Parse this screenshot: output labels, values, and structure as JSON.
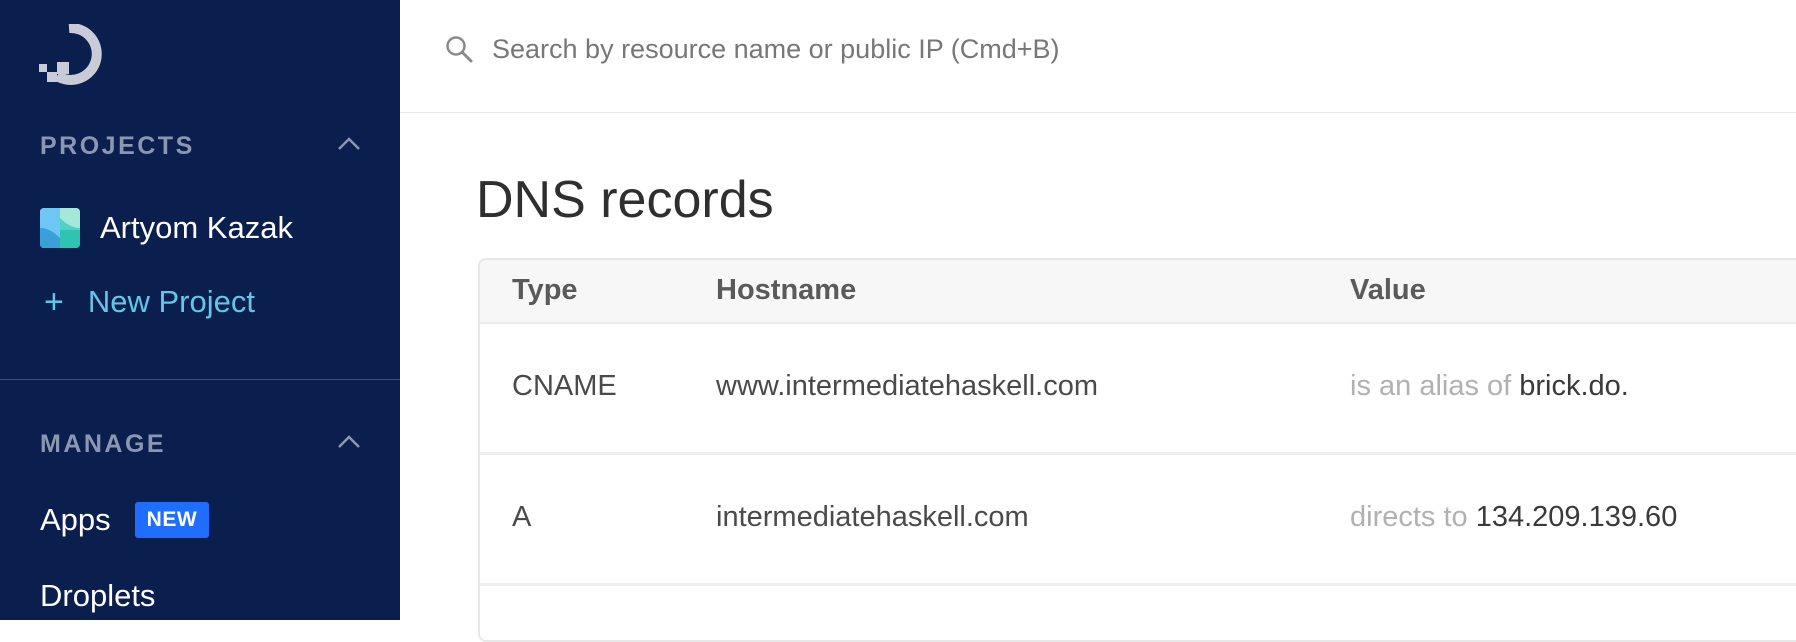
{
  "search": {
    "placeholder": "Search by resource name or public IP (Cmd+B)"
  },
  "sidebar": {
    "projects_heading": "PROJECTS",
    "project_name": "Artyom Kazak",
    "new_project": "New Project",
    "manage_heading": "MANAGE",
    "items": [
      {
        "label": "Apps",
        "badge": "NEW"
      },
      {
        "label": "Droplets"
      }
    ]
  },
  "page": {
    "title": "DNS records",
    "columns": [
      "Type",
      "Hostname",
      "Value"
    ],
    "records": [
      {
        "type": "CNAME",
        "hostname": "www.intermediatehaskell.com",
        "value_prefix": "is an alias of",
        "value": "brick.do."
      },
      {
        "type": "A",
        "hostname": "intermediatehaskell.com",
        "value_prefix": "directs to",
        "value": "134.209.139.60"
      }
    ]
  },
  "colors": {
    "sidebar_bg": "#0b1f4f",
    "accent": "#62c6e6",
    "badge": "#1f6eff"
  }
}
